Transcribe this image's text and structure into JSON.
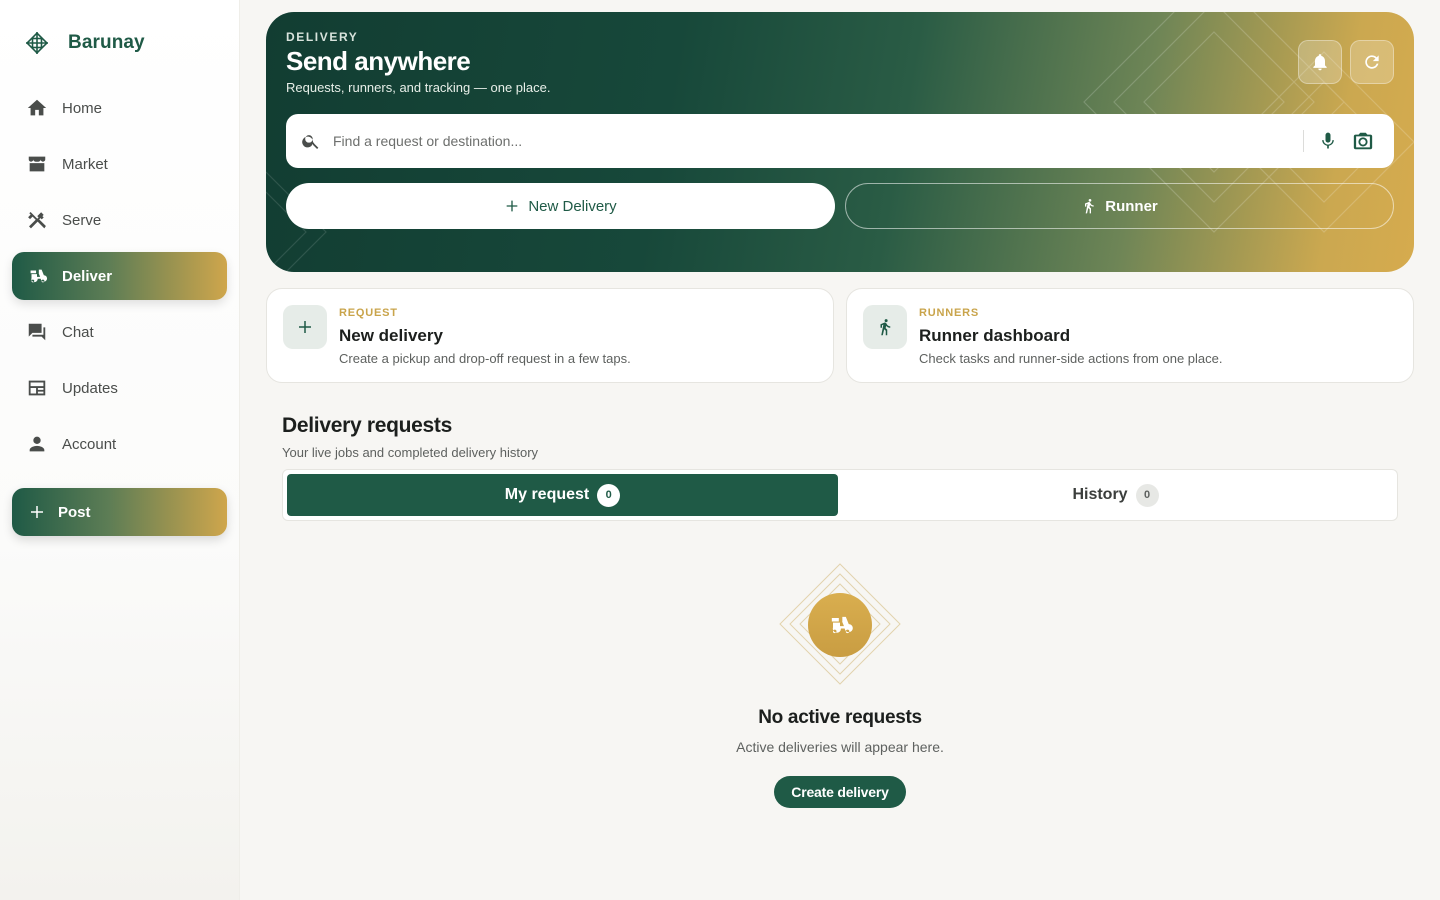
{
  "brand": {
    "name": "Barunay"
  },
  "sidebar": {
    "items": [
      {
        "label": "Home",
        "icon": "home-icon"
      },
      {
        "label": "Market",
        "icon": "store-icon"
      },
      {
        "label": "Serve",
        "icon": "tools-icon"
      },
      {
        "label": "Deliver",
        "icon": "scooter-icon",
        "active": true
      },
      {
        "label": "Chat",
        "icon": "chat-icon"
      },
      {
        "label": "Updates",
        "icon": "newspaper-icon"
      },
      {
        "label": "Account",
        "icon": "person-icon"
      }
    ],
    "post_label": "Post"
  },
  "hero": {
    "kicker": "DELIVERY",
    "title": "Send anywhere",
    "subtitle": "Requests, runners, and tracking — one place.",
    "search_placeholder": "Find a request or destination...",
    "new_delivery_label": "New Delivery",
    "runner_label": "Runner"
  },
  "cards": [
    {
      "kicker": "REQUEST",
      "title": "New delivery",
      "desc": "Create a pickup and drop-off request in a few taps."
    },
    {
      "kicker": "RUNNERS",
      "title": "Runner dashboard",
      "desc": "Check tasks and runner-side actions from one place."
    }
  ],
  "requests": {
    "title": "Delivery requests",
    "subtitle": "Your live jobs and completed delivery history",
    "tabs": [
      {
        "label": "My request",
        "count": "0"
      },
      {
        "label": "History",
        "count": "0"
      }
    ],
    "empty_title": "No active requests",
    "empty_sub": "Active deliveries will appear here.",
    "create_label": "Create delivery"
  },
  "colors": {
    "primary": "#1f5a46",
    "accent": "#cfa64c"
  }
}
